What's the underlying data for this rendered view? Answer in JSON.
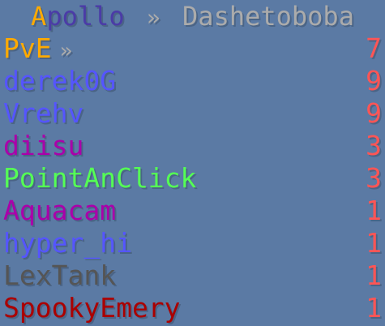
{
  "header": {
    "title_a": "A",
    "title_rest": "pollo",
    "separator": "»",
    "server": "Dashetoboba",
    "colors": {
      "title_a": "#ffaa00",
      "title_rest": "#4b3ba7",
      "server": "#ababab"
    }
  },
  "rows": [
    {
      "name": "PvE",
      "score": "7",
      "name_color": "#ffaa00",
      "has_arrow": true,
      "arrow": "»"
    },
    {
      "name": "derek0G",
      "score": "9",
      "name_color": "#5555ff"
    },
    {
      "name": "Vrehv",
      "score": "9",
      "name_color": "#5555ff"
    },
    {
      "name": "diisu",
      "score": "3",
      "name_color": "#aa00aa"
    },
    {
      "name": "PointAnClick",
      "score": "3",
      "name_color": "#55ff55"
    },
    {
      "name": "Aquacam",
      "score": "1",
      "name_color": "#aa00aa"
    },
    {
      "name": "hyper_hi",
      "score": "1",
      "name_color": "#5555ff"
    },
    {
      "name": "LexTank",
      "score": "1",
      "name_color": "#555555"
    },
    {
      "name": "SpookyEmery",
      "score": "1",
      "name_color": "#aa0000"
    }
  ],
  "score_color": "#ff5555",
  "background_color": "#5b7aa4"
}
